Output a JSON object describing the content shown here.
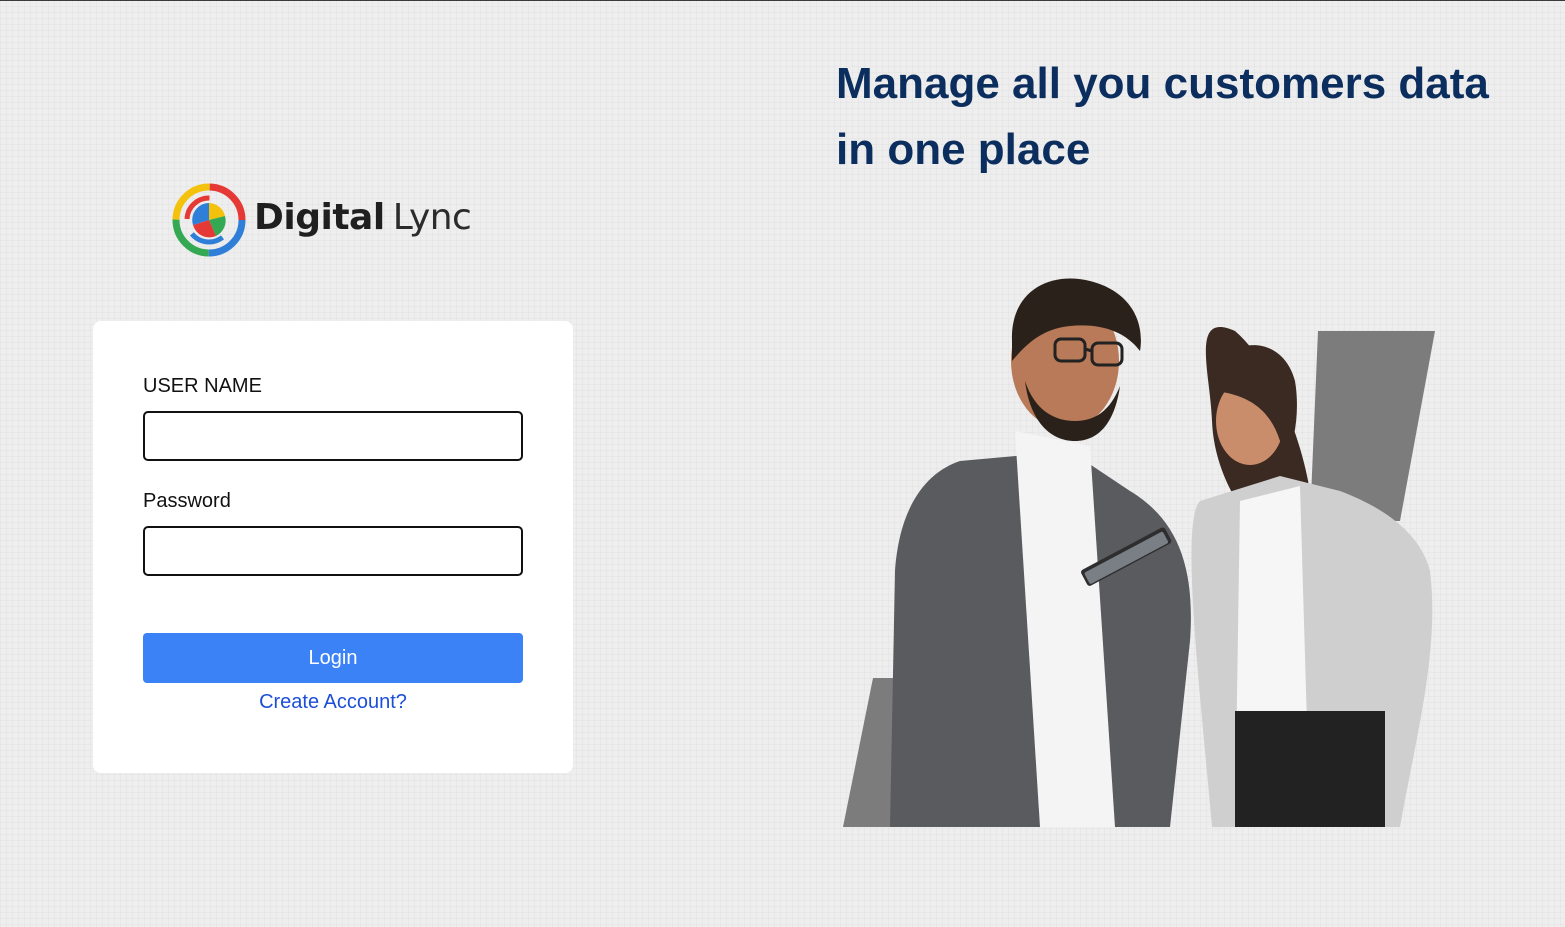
{
  "brand": {
    "name_bold": "Digital",
    "name_light": "Lync",
    "logo_icon": "digital-lync-logo-icon",
    "logo_colors": [
      "#2f7ed8",
      "#e53935",
      "#f4c20d",
      "#34a853"
    ]
  },
  "headline": {
    "text": "Manage all you customers data in one place",
    "color": "#0b2e5e"
  },
  "login_form": {
    "username_label": "USER NAME",
    "username_value": "",
    "password_label": "Password",
    "password_value": "",
    "login_button": "Login",
    "create_account_link": "Create Account?",
    "button_color": "#3b82f6",
    "link_color": "#1d4ed8"
  },
  "hero_image": {
    "subject": "two business people looking at a tablet"
  }
}
